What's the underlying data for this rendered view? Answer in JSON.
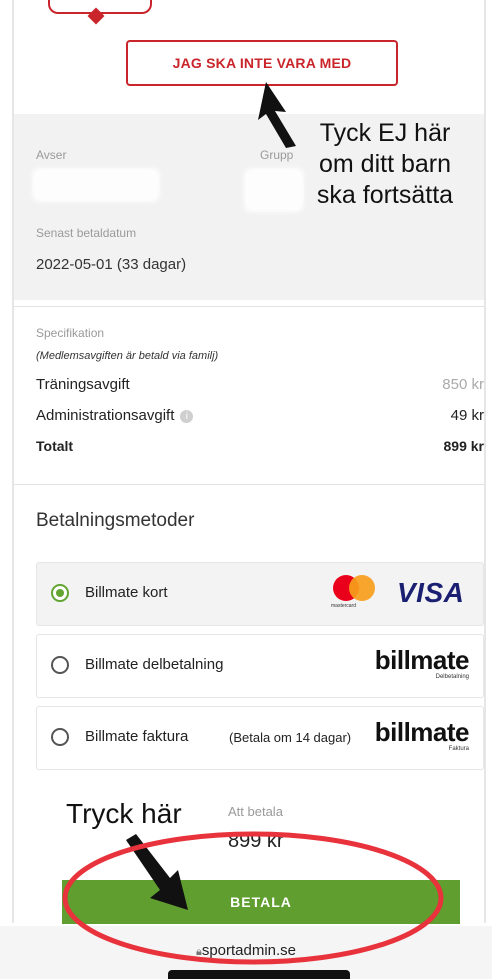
{
  "optout_button": {
    "label": "JAG SKA INTE VARA MED"
  },
  "annotations": {
    "top": [
      "Tyck EJ här",
      "om ditt barn",
      "ska fortsätta"
    ],
    "bottom": "Tryck här"
  },
  "member": {
    "avser_label": "Avser",
    "grupp_label": "Grupp",
    "senast_label": "Senast betaldatum",
    "senast_value": "2022-05-01 (33 dagar)"
  },
  "spec": {
    "label": "Specifikation",
    "note": "(Medlemsavgiften är betald via familj)",
    "rows": [
      {
        "name": "Träningsavgift",
        "amount": "850 kr"
      },
      {
        "name": "Administrationsavgift",
        "amount": "49 kr"
      }
    ],
    "total": {
      "name": "Totalt",
      "amount": "899 kr"
    }
  },
  "payment": {
    "title": "Betalningsmetoder",
    "methods": [
      {
        "label": "Billmate kort",
        "selected": true
      },
      {
        "label": "Billmate delbetalning",
        "selected": false,
        "logo": "billmate",
        "logo_sub": "Delbetalning"
      },
      {
        "label": "Billmate faktura",
        "note": "(Betala om 14 dagar)",
        "selected": false,
        "logo": "billmate",
        "logo_sub": "Faktura"
      }
    ],
    "card_logos": {
      "mastercard_text": "mastercard",
      "visa_text": "VISA"
    }
  },
  "att_betala": {
    "label": "Att betala",
    "value": "899 kr"
  },
  "pay_button": {
    "label": "BETALA"
  },
  "browser": {
    "url": "sportadmin.se"
  },
  "colors": {
    "brand_red": "#c9252b",
    "pay_green": "#5f9e2f",
    "radio_green": "#64a531",
    "annotation_ellipse": "#e8323c"
  }
}
